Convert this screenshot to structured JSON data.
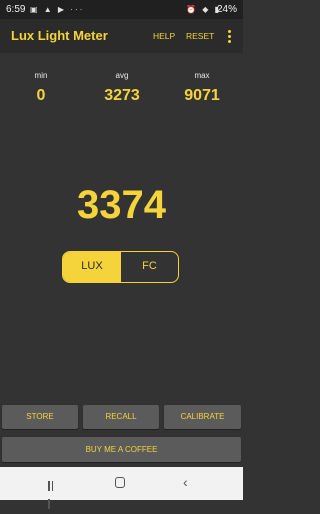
{
  "status_bar": {
    "time": "6:59",
    "battery": "24%"
  },
  "app_bar": {
    "title": "Lux Light Meter",
    "menu_help": "HELP",
    "menu_reset": "RESET"
  },
  "stats": {
    "min_label": "min",
    "min_value": "0",
    "avg_label": "avg",
    "avg_value": "3273",
    "max_label": "max",
    "max_value": "9071"
  },
  "reading": {
    "value": "3374"
  },
  "units": {
    "lux": "LUX",
    "fc": "FC",
    "selected": "LUX"
  },
  "buttons": {
    "store": "STORE",
    "recall": "RECALL",
    "calibrate": "CALIBRATE",
    "coffee": "BUY ME A COFFEE"
  },
  "colors": {
    "accent": "#f5d33a",
    "background": "#333333",
    "button": "#5b5b5b"
  }
}
